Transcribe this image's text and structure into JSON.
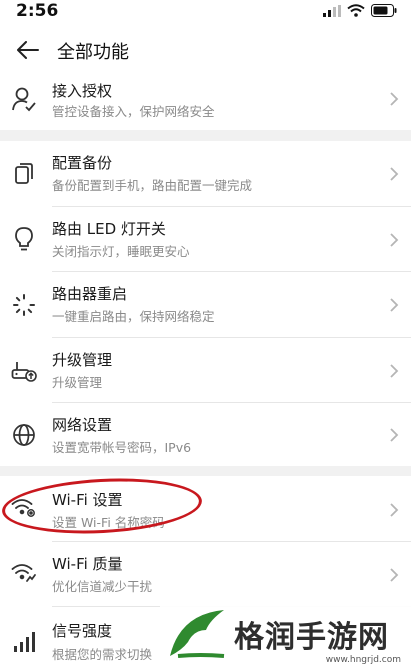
{
  "status": {
    "time": "2:56"
  },
  "header": {
    "title": "全部功能"
  },
  "rows": [
    {
      "title": "接入授权",
      "subtitle": "管控设备接入，保护网络安全",
      "icon": "person-check-icon"
    },
    {
      "title": "配置备份",
      "subtitle": "备份配置到手机，路由配置一键完成",
      "icon": "copy-icon"
    },
    {
      "title": "路由 LED 灯开关",
      "subtitle": "关闭指示灯，睡眠更安心",
      "icon": "bulb-icon"
    },
    {
      "title": "路由器重启",
      "subtitle": "一键重启路由，保持网络稳定",
      "icon": "restart-spinner-icon"
    },
    {
      "title": "升级管理",
      "subtitle": "升级管理",
      "icon": "router-upgrade-icon"
    },
    {
      "title": "网络设置",
      "subtitle": "设置宽带帐号密码，IPv6",
      "icon": "globe-icon"
    },
    {
      "title": "Wi-Fi 设置",
      "subtitle": "设置 Wi-Fi 名称密码",
      "icon": "wifi-settings-icon"
    },
    {
      "title": "Wi-Fi 质量",
      "subtitle": "优化信道减少干扰",
      "icon": "wifi-quality-icon"
    },
    {
      "title": "信号强度",
      "subtitle": "根据您的需求切换",
      "icon": "signal-strength-icon"
    }
  ],
  "watermark": {
    "text": "格润手游网",
    "url": "www.hngrjd.com"
  },
  "colors": {
    "highlight": "#c8181e",
    "logo_green": "#2f8a2f"
  }
}
